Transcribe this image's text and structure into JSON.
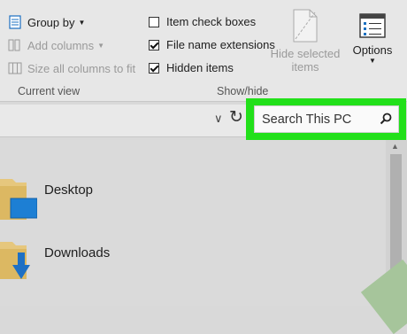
{
  "ribbon": {
    "current_view": {
      "group_by": "Group by",
      "add_columns": "Add columns",
      "size_all_columns": "Size all columns to fit",
      "label": "Current view"
    },
    "show_hide": {
      "item_check_boxes": {
        "label": "Item check boxes",
        "checked": false
      },
      "file_name_extensions": {
        "label": "File name extensions",
        "checked": true
      },
      "hidden_items": {
        "label": "Hidden items",
        "checked": true
      },
      "hide_selected_line1": "Hide selected",
      "hide_selected_line2": "items",
      "label": "Show/hide"
    },
    "options": {
      "label": "Options"
    }
  },
  "address_bar": {
    "search": {
      "placeholder": "Search This PC",
      "highlight_color": "#22e01a"
    }
  },
  "nav_items": [
    {
      "label": "Desktop",
      "icon": "desktop-folder-icon"
    },
    {
      "label": "Downloads",
      "icon": "downloads-folder-icon"
    }
  ],
  "colors": {
    "folder": "#e6c77d",
    "desktop_blue": "#1d7fd4",
    "download_blue": "#1e70c4"
  }
}
